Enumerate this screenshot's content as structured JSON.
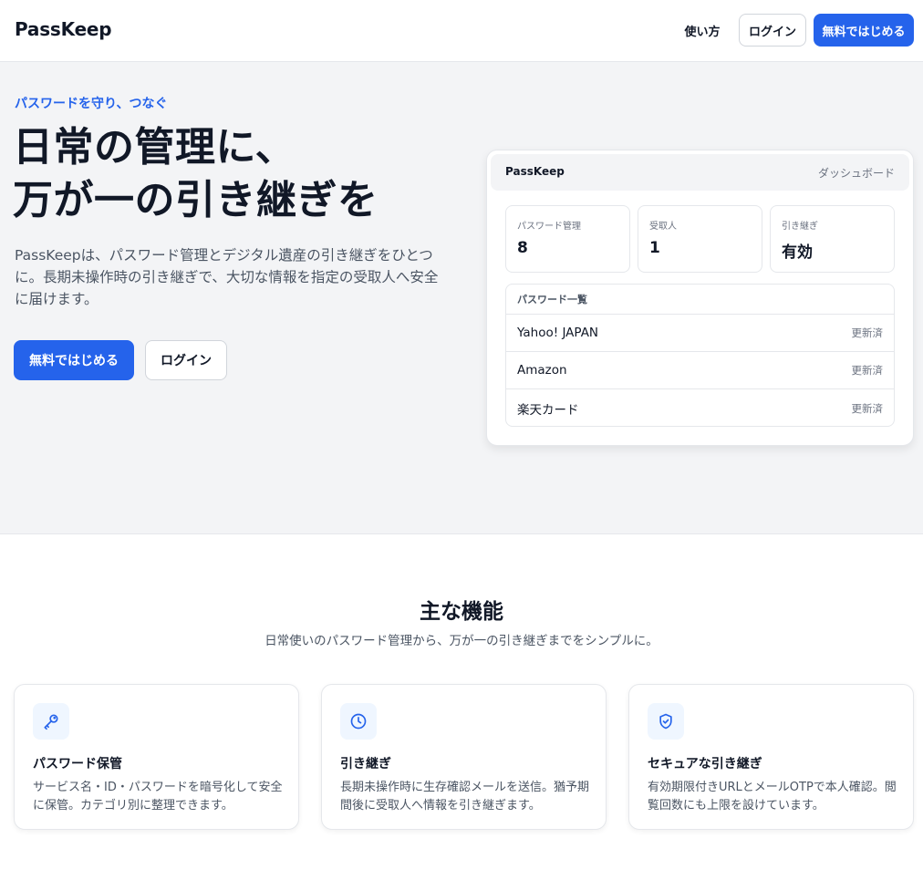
{
  "header": {
    "logo": "PassKeep",
    "how_to": "使い方",
    "login": "ログイン",
    "start_free": "無料ではじめる"
  },
  "hero": {
    "eyebrow": "パスワードを守り、つなぐ",
    "title_line1": "日常の管理に、",
    "title_line2": "万が一の引き継ぎを",
    "description": "PassKeepは、パスワード管理とデジタル遺産の引き継ぎをひとつに。長期未操作時の引き継ぎで、大切な情報を指定の受取人へ安全に届けます。",
    "start_free": "無料ではじめる",
    "login": "ログイン"
  },
  "dashboard": {
    "brand": "PassKeep",
    "nav": "ダッシュボード",
    "stats": [
      {
        "label": "パスワード管理",
        "value": "8"
      },
      {
        "label": "受取人",
        "value": "1"
      },
      {
        "label": "引き継ぎ",
        "value": "有効"
      }
    ],
    "list_title": "パスワード一覧",
    "items": [
      {
        "name": "Yahoo! JAPAN",
        "status": "更新済"
      },
      {
        "name": "Amazon",
        "status": "更新済"
      },
      {
        "name": "楽天カード",
        "status": "更新済"
      }
    ]
  },
  "features": {
    "title": "主な機能",
    "subtitle": "日常使いのパスワード管理から、万が一の引き継ぎまでをシンプルに。",
    "cards": [
      {
        "icon": "key-icon",
        "title": "パスワード保管",
        "desc": "サービス名・ID・パスワードを暗号化して安全に保管。カテゴリ別に整理できます。"
      },
      {
        "icon": "clock-icon",
        "title": "引き継ぎ",
        "desc": "長期未操作時に生存確認メールを送信。猶予期間後に受取人へ情報を引き継ぎます。"
      },
      {
        "icon": "shield-check-icon",
        "title": "セキュアな引き継ぎ",
        "desc": "有効期限付きURLとメールOTPで本人確認。閲覧回数にも上限を設けています。"
      }
    ]
  },
  "colors": {
    "accent": "#2563eb",
    "icon_bg": "#eff6ff",
    "hero_bg": "#f3f4f6"
  }
}
